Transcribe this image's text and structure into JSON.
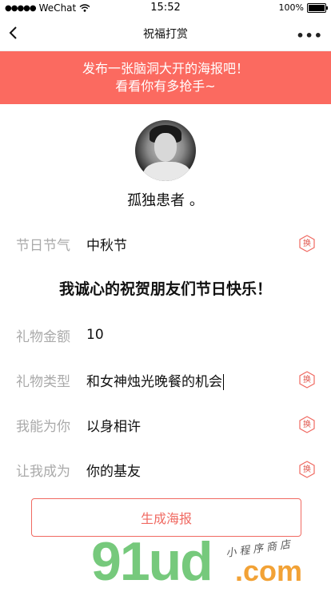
{
  "status_bar": {
    "carrier": "WeChat",
    "time": "15:52",
    "battery": "100%"
  },
  "nav": {
    "title": "祝福打赏",
    "more": "•••"
  },
  "banner": {
    "line1": "发布一张脑洞大开的海报吧！",
    "line2": "看看你有多抢手~"
  },
  "profile": {
    "nickname": "孤独患者 。"
  },
  "rows": [
    {
      "label": "节日节气",
      "value": "中秋节",
      "swap": "换"
    },
    {
      "label": "礼物金额",
      "value": "10"
    },
    {
      "label": "礼物类型",
      "value": "和女神烛光晚餐的机会",
      "swap": "换"
    },
    {
      "label": "我能为你",
      "value": "以身相许",
      "swap": "换"
    },
    {
      "label": "让我成为",
      "value": "你的基友",
      "swap": "换"
    }
  ],
  "greeting": "我诚心的祝贺朋友们节日快乐！",
  "button": {
    "label": "生成海报"
  },
  "watermark": {
    "brand": "91ud",
    "domain": ".com",
    "tagline": "小程序商店"
  },
  "colors": {
    "banner": "#fb6a60",
    "accent": "#f06a62"
  }
}
